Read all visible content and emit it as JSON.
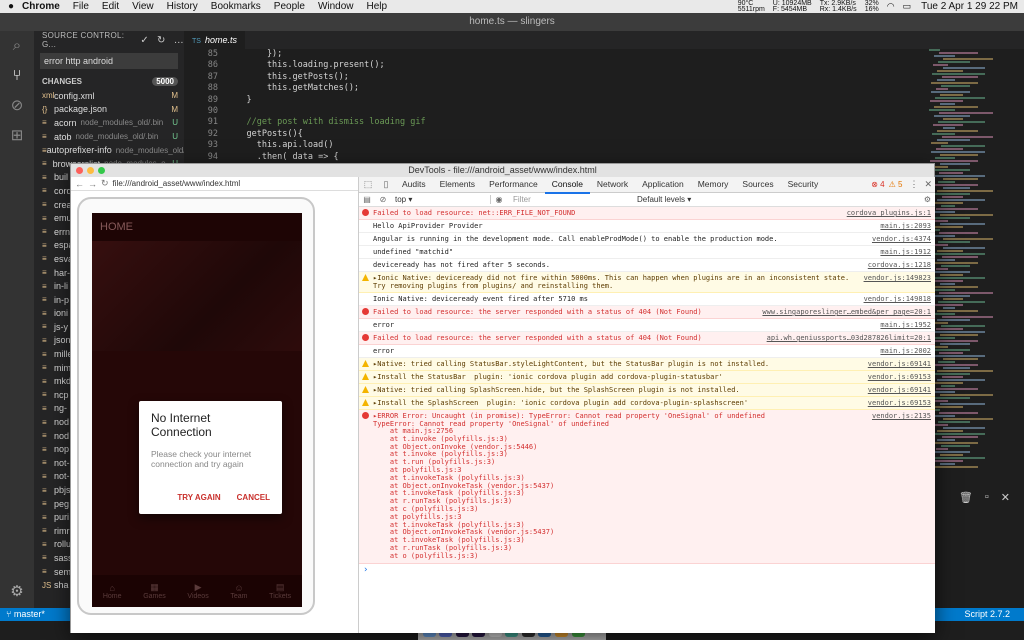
{
  "menubar": {
    "apple": "",
    "items": [
      "Chrome",
      "File",
      "Edit",
      "View",
      "History",
      "Bookmarks",
      "People",
      "Window",
      "Help"
    ],
    "temp": "90°C",
    "rpm": "5511rpm",
    "mem_u": "U: 10924MB",
    "mem_f": "F: 5454MB",
    "net_tx": "Tx: 2.9KB/s",
    "net_rx": "Rx: 1.4KB/s",
    "cpu1": "32%",
    "cpu2": "16%",
    "clock": "Tue 2 Apr  1 29 22 PM"
  },
  "vscode": {
    "title": "home.ts — slingers",
    "scm_header": "SOURCE CONTROL: G...",
    "commit_message": "error http android",
    "changes_label": "CHANGES",
    "changes_count": "5000",
    "files": [
      {
        "icon": "xml",
        "name": "config.xml",
        "path": "",
        "status": "M"
      },
      {
        "icon": "{}",
        "name": "package.json",
        "path": "",
        "status": "M"
      },
      {
        "icon": "≡",
        "name": "acorn",
        "path": "node_modules_old/.bin",
        "status": "U"
      },
      {
        "icon": "≡",
        "name": "atob",
        "path": "node_modules_old/.bin",
        "status": "U"
      },
      {
        "icon": "≡",
        "name": "autoprefixer-info",
        "path": "node_modules_old/...",
        "status": "U"
      },
      {
        "icon": "≡",
        "name": "browserslist",
        "path": "node_modules_o...",
        "status": "U"
      },
      {
        "icon": "≡",
        "name": "buil",
        "path": "",
        "status": ""
      },
      {
        "icon": "≡",
        "name": "cord",
        "path": "",
        "status": ""
      },
      {
        "icon": "≡",
        "name": "crea",
        "path": "",
        "status": ""
      },
      {
        "icon": "≡",
        "name": "emu",
        "path": "",
        "status": ""
      },
      {
        "icon": "≡",
        "name": "errn",
        "path": "",
        "status": ""
      },
      {
        "icon": "≡",
        "name": "espa",
        "path": "",
        "status": ""
      },
      {
        "icon": "≡",
        "name": "esva",
        "path": "",
        "status": ""
      },
      {
        "icon": "≡",
        "name": "har-",
        "path": "",
        "status": ""
      },
      {
        "icon": "≡",
        "name": "in-li",
        "path": "",
        "status": ""
      },
      {
        "icon": "≡",
        "name": "in-p",
        "path": "",
        "status": ""
      },
      {
        "icon": "≡",
        "name": "ioni",
        "path": "",
        "status": ""
      },
      {
        "icon": "≡",
        "name": "js-y",
        "path": "",
        "status": ""
      },
      {
        "icon": "≡",
        "name": "json",
        "path": "",
        "status": ""
      },
      {
        "icon": "≡",
        "name": "mille",
        "path": "",
        "status": ""
      },
      {
        "icon": "≡",
        "name": "mim",
        "path": "",
        "status": ""
      },
      {
        "icon": "≡",
        "name": "mkd",
        "path": "",
        "status": ""
      },
      {
        "icon": "≡",
        "name": "ncp",
        "path": "",
        "status": ""
      },
      {
        "icon": "≡",
        "name": "ng-",
        "path": "",
        "status": ""
      },
      {
        "icon": "≡",
        "name": "nod",
        "path": "",
        "status": ""
      },
      {
        "icon": "≡",
        "name": "nod",
        "path": "",
        "status": ""
      },
      {
        "icon": "≡",
        "name": "nop",
        "path": "",
        "status": ""
      },
      {
        "icon": "≡",
        "name": "not-",
        "path": "",
        "status": ""
      },
      {
        "icon": "≡",
        "name": "not-",
        "path": "",
        "status": ""
      },
      {
        "icon": "≡",
        "name": "pbjs",
        "path": "",
        "status": ""
      },
      {
        "icon": "≡",
        "name": "peg",
        "path": "",
        "status": ""
      },
      {
        "icon": "≡",
        "name": "puri",
        "path": "",
        "status": ""
      },
      {
        "icon": "≡",
        "name": "rimr",
        "path": "",
        "status": ""
      },
      {
        "icon": "≡",
        "name": "rollu",
        "path": "",
        "status": ""
      },
      {
        "icon": "≡",
        "name": "sass",
        "path": "",
        "status": ""
      },
      {
        "icon": "≡",
        "name": "sem",
        "path": "",
        "status": ""
      },
      {
        "icon": "JS",
        "name": "sha",
        "path": "",
        "status": ""
      }
    ],
    "tab_icon": "TS",
    "tab_name": "home.ts",
    "code_lines": [
      {
        "n": "85",
        "t": "        });"
      },
      {
        "n": "86",
        "t": "        this.loading.present();"
      },
      {
        "n": "87",
        "t": "        this.getPosts();"
      },
      {
        "n": "88",
        "t": "        this.getMatches();"
      },
      {
        "n": "89",
        "t": "    }"
      },
      {
        "n": "90",
        "t": ""
      },
      {
        "n": "91",
        "t": "    //get post with dismiss loading gif"
      },
      {
        "n": "92",
        "t": "    getPosts(){"
      },
      {
        "n": "93",
        "t": "      this.api.load()"
      },
      {
        "n": "94",
        "t": "      .then( data => {"
      },
      {
        "n": "95",
        "t": "        this.datas = data;"
      }
    ],
    "status_branch": "master*",
    "status_right": "Script   2.7.2"
  },
  "devtools": {
    "title": "DevTools - file:///android_asset/www/index.html",
    "address": "file:///android_asset/www/index.html",
    "tabs": [
      "Audits",
      "Elements",
      "Performance",
      "Console",
      "Network",
      "Application",
      "Memory",
      "Sources",
      "Security"
    ],
    "active_tab": "Console",
    "error_count": "4",
    "warn_count": "5",
    "context": "top",
    "filter_placeholder": "Filter",
    "levels": "Default levels ▾",
    "messages": [
      {
        "type": "err",
        "text": "Failed to load resource: net::ERR_FILE_NOT_FOUND",
        "src": "cordova_plugins.js:1"
      },
      {
        "type": "log",
        "text": "Hello ApiProvider Provider",
        "src": "main.js:2093"
      },
      {
        "type": "log",
        "text": "Angular is running in the development mode. Call enableProdMode() to enable the production mode.",
        "src": "vendor.js:4374"
      },
      {
        "type": "log",
        "text": "undefined \"matchid\"",
        "src": "main.js:1912"
      },
      {
        "type": "log",
        "text": "deviceready has not fired after 5 seconds.",
        "src": "cordova.js:1218"
      },
      {
        "type": "warn",
        "text": "▸Ionic Native: deviceready did not fire within 5000ms. This can happen when plugins are in an inconsistent state. Try removing plugins from plugins/ and reinstalling them.",
        "src": "vendor.js:149823"
      },
      {
        "type": "log",
        "text": "Ionic Native: deviceready event fired after 5710 ms",
        "src": "vendor.js:149818"
      },
      {
        "type": "err",
        "text": "Failed to load resource: the server responded with a status of 404 (Not Found)",
        "src": "www.singaporeslinger…embed&per_page=20:1"
      },
      {
        "type": "log",
        "text": "error",
        "src": "main.js:1952"
      },
      {
        "type": "err",
        "text": "Failed to load resource: the server responded with a status of 404 (Not Found)",
        "src": "api.wh.geniussports…03d287826limit=20:1"
      },
      {
        "type": "log",
        "text": "error",
        "src": "main.js:2002"
      },
      {
        "type": "warn",
        "text": "▸Native: tried calling StatusBar.styleLightContent, but the StatusBar plugin is not installed.",
        "src": "vendor.js:69141"
      },
      {
        "type": "warn",
        "text": "▸Install the StatusBar  plugin: 'ionic cordova plugin add cordova-plugin-statusbar'",
        "src": "vendor.js:69153"
      },
      {
        "type": "warn",
        "text": "▸Native: tried calling SplashScreen.hide, but the SplashScreen plugin is not installed.",
        "src": "vendor.js:69141"
      },
      {
        "type": "warn",
        "text": "▸Install the SplashScreen  plugin: 'ionic cordova plugin add cordova-plugin-splashscreen'",
        "src": "vendor.js:69153"
      }
    ],
    "error_head": "▸ERROR Error: Uncaught (in promise): TypeError: Cannot read property 'OneSignal' of undefined\nTypeError: Cannot read property 'OneSignal' of undefined",
    "error_src": "vendor.js:2135",
    "stack": [
      "    at main.js:2756",
      "    at t.invoke (polyfills.js:3)",
      "    at Object.onInvoke (vendor.js:5446)",
      "    at t.invoke (polyfills.js:3)",
      "    at t.run (polyfills.js:3)",
      "    at polyfills.js:3",
      "    at t.invokeTask (polyfills.js:3)",
      "    at Object.onInvokeTask (vendor.js:5437)",
      "    at t.invokeTask (polyfills.js:3)",
      "    at r.runTask (polyfills.js:3)",
      "    at c (polyfills.js:3)",
      "    at polyfills.js:3",
      "    at t.invokeTask (polyfills.js:3)",
      "    at Object.onInvokeTask (vendor.js:5437)",
      "    at t.invokeTask (polyfills.js:3)",
      "    at r.runTask (polyfills.js:3)",
      "    at o (polyfills.js:3)"
    ],
    "prompt": "›"
  },
  "app": {
    "header": "HOME",
    "dialog_title": "No Internet Connection",
    "dialog_message": "Please check your internet connection and try again",
    "try_again": "TRY AGAIN",
    "cancel": "CANCEL",
    "tabs": [
      {
        "icon": "⌂",
        "label": "Home"
      },
      {
        "icon": "▦",
        "label": "Games"
      },
      {
        "icon": "▶",
        "label": "Videos"
      },
      {
        "icon": "☺",
        "label": "Team"
      },
      {
        "icon": "▤",
        "label": "Tickets"
      }
    ]
  },
  "colors": {
    "accent": "#007acc",
    "error": "#d32f2f",
    "warn": "#f4b400",
    "dialog_button": "#c9302c"
  }
}
